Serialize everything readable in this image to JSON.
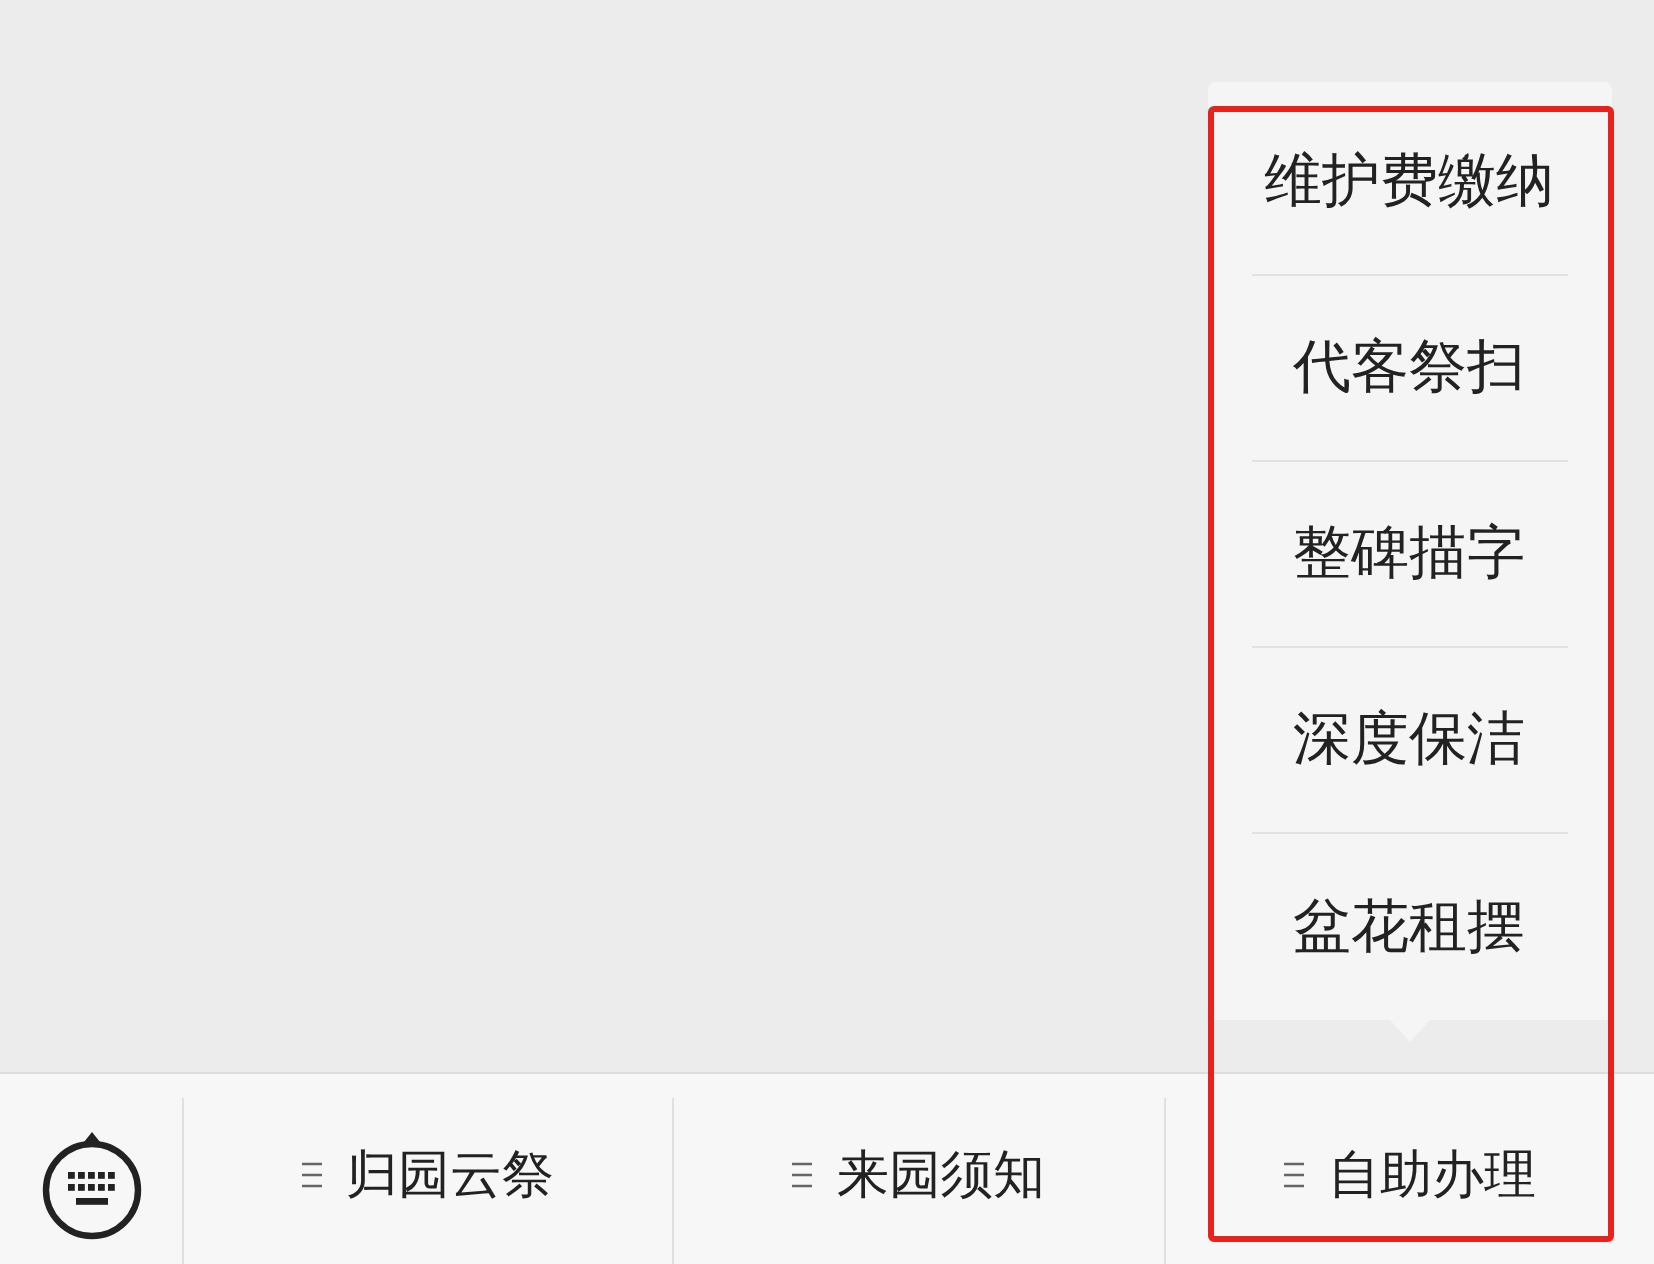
{
  "menu_bar": {
    "keyboard_button": {
      "kind": "keyboard"
    },
    "buttons": [
      {
        "label": "归园云祭",
        "expanded": false,
        "highlighted": false
      },
      {
        "label": "来园须知",
        "expanded": false,
        "highlighted": false
      },
      {
        "label": "自助办理",
        "expanded": true,
        "highlighted": true,
        "submenu": [
          "维护费缴纳",
          "代客祭扫",
          "整碑描字",
          "深度保洁",
          "盆花租摆"
        ]
      }
    ]
  }
}
